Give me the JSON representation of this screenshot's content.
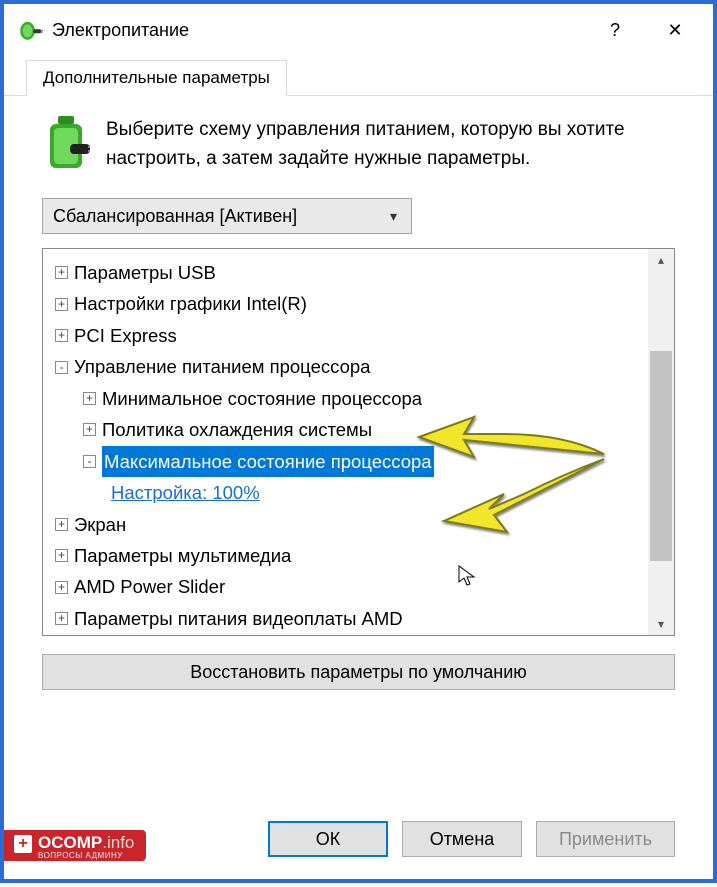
{
  "window": {
    "title": "Электропитание",
    "help_symbol": "?",
    "close_symbol": "✕"
  },
  "tab": {
    "label": "Дополнительные параметры"
  },
  "intro": {
    "text": "Выберите схему управления питанием, которую вы хотите настроить, а затем задайте нужные параметры."
  },
  "plan_select": {
    "value": "Сбалансированная [Активен]"
  },
  "tree": {
    "nodes": [
      {
        "level": 1,
        "toggle": "+",
        "label": "Параметры USB"
      },
      {
        "level": 1,
        "toggle": "+",
        "label": "Настройки графики Intel(R)"
      },
      {
        "level": 1,
        "toggle": "+",
        "label": "PCI Express"
      },
      {
        "level": 1,
        "toggle": "-",
        "label": "Управление питанием процессора"
      },
      {
        "level": 2,
        "toggle": "+",
        "label": "Минимальное состояние процессора"
      },
      {
        "level": 2,
        "toggle": "+",
        "label": "Политика охлаждения системы"
      },
      {
        "level": 2,
        "toggle": "-",
        "label": "Максимальное состояние процессора",
        "selected": true
      },
      {
        "level": 3,
        "toggle": "",
        "label": "Настройка: 100%",
        "link": true
      },
      {
        "level": 1,
        "toggle": "+",
        "label": "Экран"
      },
      {
        "level": 1,
        "toggle": "+",
        "label": "Параметры мультимедиа"
      },
      {
        "level": 1,
        "toggle": "+",
        "label": "AMD Power Slider"
      },
      {
        "level": 1,
        "toggle": "+",
        "label": "Параметры питания видеоплаты AMD"
      }
    ]
  },
  "buttons": {
    "restore": "Восстановить параметры по умолчанию",
    "ok": "ОК",
    "cancel": "Отмена",
    "apply": "Применить"
  },
  "watermark": {
    "brand": "OCOMP",
    "domain": ".info",
    "tagline": "ВОПРОСЫ АДМИНУ"
  }
}
